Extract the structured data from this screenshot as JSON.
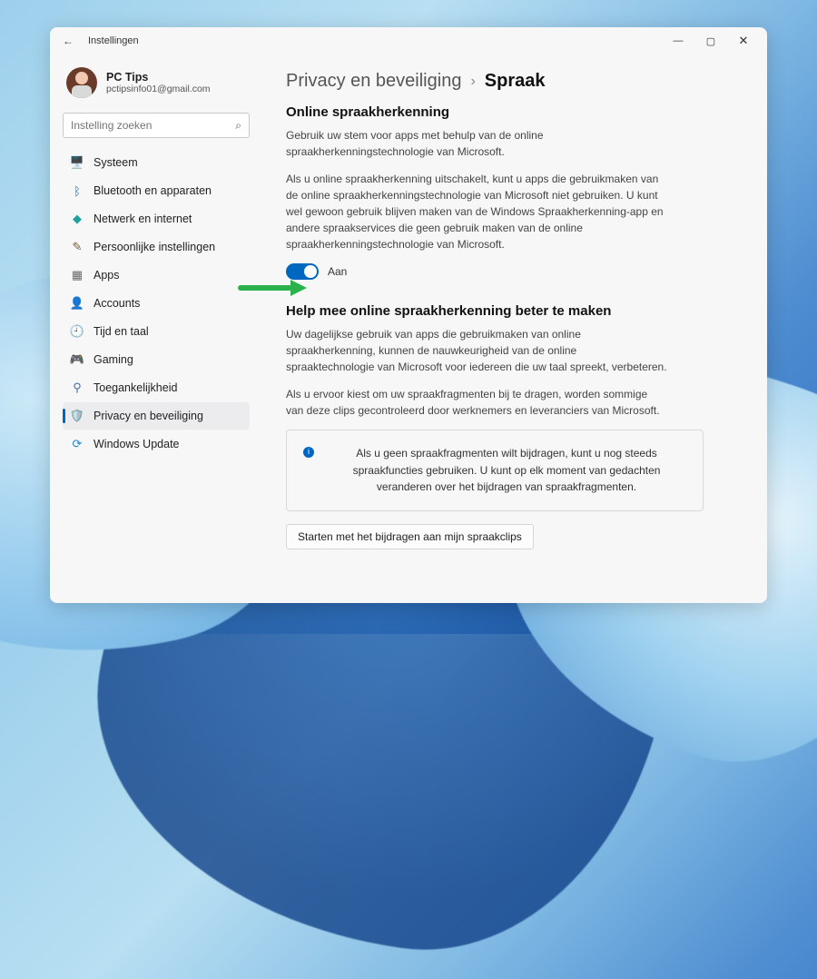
{
  "window": {
    "title": "Instellingen"
  },
  "profile": {
    "name": "PC Tips",
    "email": "pctipsinfo01@gmail.com"
  },
  "search": {
    "placeholder": "Instelling zoeken"
  },
  "sidebar": {
    "items": [
      {
        "id": "system",
        "label": "Systeem",
        "icon": "🖥️",
        "color": "#2173c9"
      },
      {
        "id": "bluetooth",
        "label": "Bluetooth en apparaten",
        "icon": "ᛒ",
        "color": "#1d6fd1"
      },
      {
        "id": "network",
        "label": "Netwerk en internet",
        "icon": "◆",
        "color": "#21a0a0"
      },
      {
        "id": "personalize",
        "label": "Persoonlijke instellingen",
        "icon": "✎",
        "color": "#7a5c3b"
      },
      {
        "id": "apps",
        "label": "Apps",
        "icon": "▦",
        "color": "#6b6b6b"
      },
      {
        "id": "accounts",
        "label": "Accounts",
        "icon": "👤",
        "color": "#c59a3f"
      },
      {
        "id": "time",
        "label": "Tijd en taal",
        "icon": "🕘",
        "color": "#5b7fa3"
      },
      {
        "id": "gaming",
        "label": "Gaming",
        "icon": "🎮",
        "color": "#5a5a5a"
      },
      {
        "id": "access",
        "label": "Toegankelijkheid",
        "icon": "⚲",
        "color": "#4a6ea9"
      },
      {
        "id": "privacy",
        "label": "Privacy en beveiliging",
        "icon": "🛡️",
        "color": "#7a8a97",
        "active": true
      },
      {
        "id": "update",
        "label": "Windows Update",
        "icon": "⟳",
        "color": "#1f86d1"
      }
    ]
  },
  "breadcrumb": {
    "parent": "Privacy en beveiliging",
    "current": "Spraak"
  },
  "section1": {
    "heading": "Online spraakherkenning",
    "p1": "Gebruik uw stem voor apps met behulp van de online spraakherkenningstechnologie van Microsoft.",
    "p2": "Als u online spraakherkenning uitschakelt, kunt u apps die gebruikmaken van de online spraakherkenningstechnologie van Microsoft niet gebruiken. U kunt wel gewoon gebruik blijven maken van de Windows Spraakherkenning-app en andere spraakservices die geen gebruik maken van de online spraakherkenningstechnologie van Microsoft.",
    "toggle_state": true,
    "toggle_label": "Aan"
  },
  "section2": {
    "heading": "Help mee online spraakherkenning beter te maken",
    "p1": "Uw dagelijkse gebruik van apps die gebruikmaken van online spraakherkenning, kunnen de nauwkeurigheid van de online spraaktechnologie van Microsoft voor iedereen die uw taal spreekt, verbeteren.",
    "p2": "Als u ervoor kiest om uw spraakfragmenten bij te dragen, worden sommige van deze clips gecontroleerd door werknemers en leveranciers van Microsoft.",
    "info": "Als u geen spraakfragmenten wilt bijdragen, kunt u nog steeds spraakfuncties gebruiken. U kunt op elk moment van gedachten veranderen over het bijdragen van spraakfragmenten.",
    "action": "Starten met het bijdragen aan mijn spraakclips"
  },
  "colors": {
    "accent": "#0067c0",
    "arrow": "#2bb24c"
  }
}
